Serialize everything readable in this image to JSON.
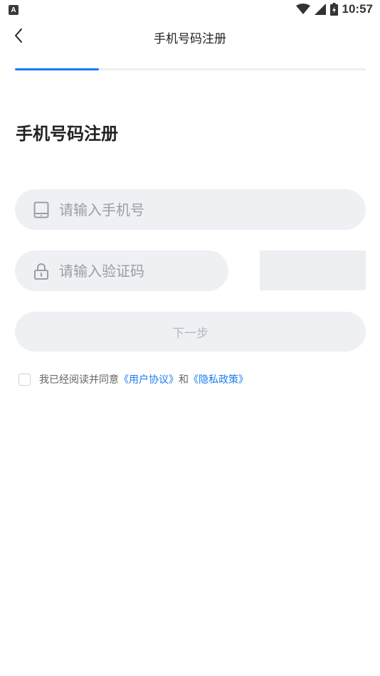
{
  "status_bar": {
    "app_badge": "A",
    "time": "10:57"
  },
  "nav": {
    "title": "手机号码注册",
    "back_icon": "chevron-left-icon"
  },
  "progress": {
    "fraction": 0.24,
    "accent_color": "#1a7cf0"
  },
  "page": {
    "title": "手机号码注册"
  },
  "form": {
    "phone": {
      "placeholder": "请输入手机号",
      "value": "",
      "icon": "phone-icon"
    },
    "code": {
      "placeholder": "请输入验证码",
      "value": "",
      "icon": "lock-icon"
    },
    "next_button": "下一步"
  },
  "agreement": {
    "checked": false,
    "prefix": "我已经阅读并同意",
    "user_agreement": "《用户协议》",
    "conjunction": "和",
    "privacy_policy": "《隐私政策》"
  }
}
